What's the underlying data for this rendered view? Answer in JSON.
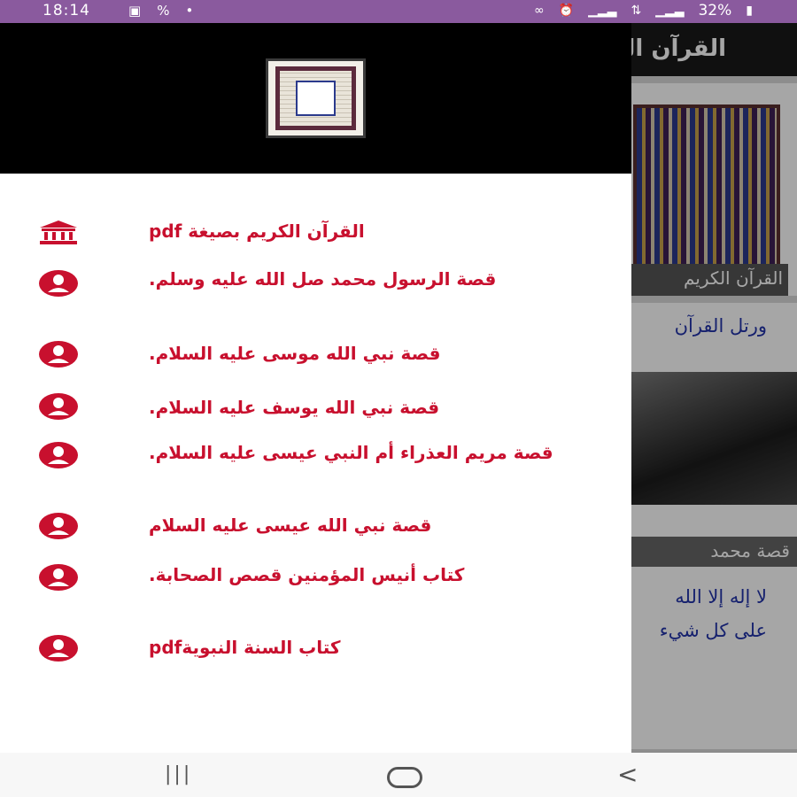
{
  "status_bar": {
    "time": "18:14",
    "battery": "32%",
    "left_icons": [
      "gallery-icon",
      "vpn-icon",
      "dot-icon"
    ],
    "right_icons": [
      "link-icon",
      "alarm-icon",
      "signal-icon",
      "data-arrows-icon",
      "signal-icon-2",
      "battery-icon"
    ]
  },
  "background": {
    "app_title": "القرآن الكريم",
    "card1_caption": "القرآن الكريم",
    "card2_text": "ورتل القرآن",
    "card3_caption": "قصة محمد",
    "card3_line1": "لا إله إلا الله",
    "card3_line2": "على كل شيء"
  },
  "drawer": {
    "menu": [
      {
        "label": "القرآن الكريم بصيغة pdf",
        "icon": "bank-icon"
      },
      {
        "label": "قصة الرسول محمد صل الله عليه وسلم.",
        "icon": "account-circle-icon"
      },
      {
        "label": "قصة نبي الله موسى عليه السلام.",
        "icon": "account-circle-icon"
      },
      {
        "label": "قصة نبي الله يوسف عليه السلام.",
        "icon": "account-circle-icon"
      },
      {
        "label": "قصة مريم العذراء أم النبي عيسى عليه السلام.",
        "icon": "account-circle-icon"
      },
      {
        "label": "قصة نبي الله عيسى عليه السلام",
        "icon": "account-circle-icon"
      },
      {
        "label": "كتاب أنيس المؤمنين قصص الصحابة.",
        "icon": "account-circle-icon"
      },
      {
        "label": "كتاب السنة النبويةpdf",
        "icon": "account-circle-icon"
      }
    ]
  },
  "colors": {
    "status_bar": "#8a5a9e",
    "menu_text": "#c8102e",
    "header_bg": "#000000"
  }
}
